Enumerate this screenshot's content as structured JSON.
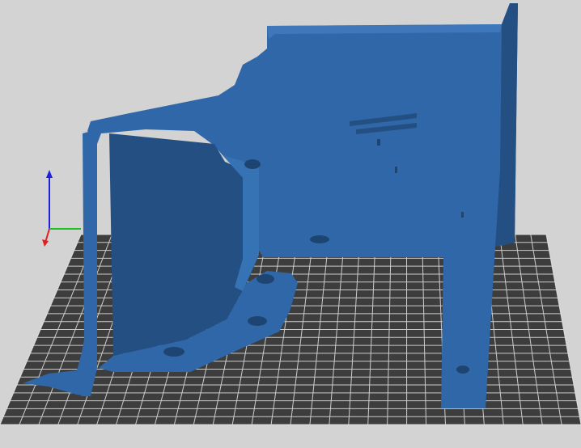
{
  "viewport": {
    "background_color": "#d3d3d3",
    "bed": {
      "surface_color": "#3d3d3d",
      "grid_line_color": "#e6e6e6"
    },
    "model": {
      "color": "#2f67a8",
      "shadow_color": "#244f82",
      "highlight_color": "#4a86c8"
    },
    "axes": {
      "x_color": "#e02020",
      "y_color": "#20c020",
      "z_color": "#2020e0"
    }
  }
}
